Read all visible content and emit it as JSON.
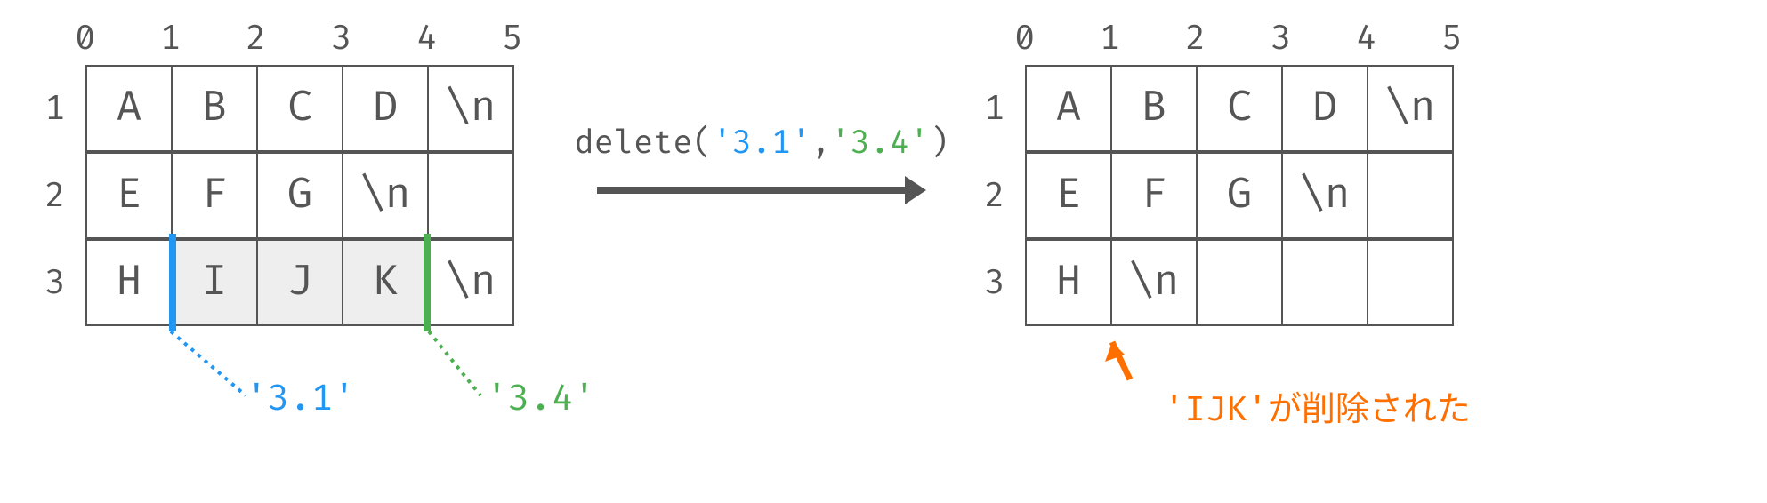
{
  "columns": [
    "0",
    "1",
    "2",
    "3",
    "4",
    "5"
  ],
  "rows": [
    "1",
    "2",
    "3"
  ],
  "left_grid": [
    [
      "A",
      "B",
      "C",
      "D",
      "\\n"
    ],
    [
      "E",
      "F",
      "G",
      "\\n",
      ""
    ],
    [
      "H",
      "I",
      "J",
      "K",
      "\\n"
    ]
  ],
  "right_grid": [
    [
      "A",
      "B",
      "C",
      "D",
      "\\n"
    ],
    [
      "E",
      "F",
      "G",
      "\\n",
      ""
    ],
    [
      "H",
      "\\n",
      "",
      "",
      ""
    ]
  ],
  "highlight": {
    "row": 3,
    "from_col": 1,
    "to_col": 4
  },
  "cursors": {
    "start": "'3.1'",
    "end": "'3.4'"
  },
  "call": {
    "fn": "delete(",
    "arg1": "'3.1'",
    "sep": ",",
    "arg2": "'3.4'",
    "close": ")"
  },
  "result_note": "'IJK'が削除された",
  "colors": {
    "blue": "#2196F3",
    "green": "#4CAF50",
    "orange": "#FF6F00",
    "ink": "#555"
  }
}
